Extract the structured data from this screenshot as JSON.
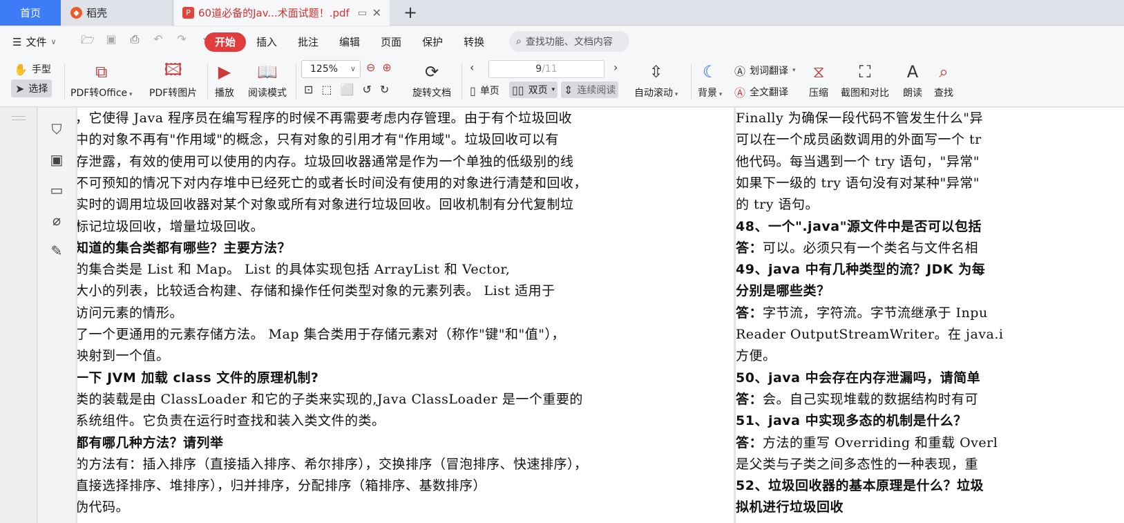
{
  "tabs": {
    "home": "首页",
    "daoke": "稻壳",
    "pdf": "60道必备的Jav...术面试题！.pdf",
    "add": "+"
  },
  "menu": {
    "file": "文件",
    "items": [
      "开始",
      "插入",
      "批注",
      "编辑",
      "页面",
      "保护",
      "转换"
    ],
    "search_placeholder": "查找功能、文档内容"
  },
  "ribbon": {
    "hand": "手型",
    "select": "选择",
    "pdf_to_office": "PDF转Office",
    "pdf_to_image": "PDF转图片",
    "play": "播放",
    "read_mode": "阅读模式",
    "zoom": "125%",
    "rotate": "旋转文档",
    "page_current": "9",
    "page_total": "/11",
    "single": "单页",
    "double": "双页",
    "continuous": "连续阅读",
    "auto_scroll": "自动滚动",
    "background": "背景",
    "word_translate": "划词翻译",
    "full_translate": "全文翻译",
    "compress": "压缩",
    "screenshot": "截图和对比",
    "read_aloud": "朗读",
    "find": "查找"
  },
  "left_page": {
    "lines": [
      "，它使得 Java 程序员在编写程序的时候不再需要考虑内存管理。由于有个垃圾回收",
      "中的对象不再有\"作用域\"的概念，只有对象的引用才有\"作用域\"。垃圾回收可以有",
      "存泄露，有效的使用可以使用的内存。垃圾回收器通常是作为一个单独的低级别的线",
      "不可预知的情况下对内存堆中已经死亡的或者长时间没有使用的对象进行清楚和回收，",
      "实时的调用垃圾回收器对某个对象或所有对象进行垃圾回收。回收机制有分代复制垃",
      "标记垃圾回收，增量垃圾回收。",
      "知道的集合类都有哪些？主要方法？",
      "的集合类是  List  和  Map。  List  的具体实现包括  ArrayList  和  Vector,",
      "大小的列表，比较适合构建、存储和操作任何类型对象的元素列表。  List  适用于",
      "访问元素的情形。",
      "了一个更通用的元素存储方法。  Map  集合类用于存储元素对（称作\"键\"和\"值\"），",
      "映射到一个值。",
      "一下 JVM 加载 class 文件的原理机制?",
      "类的装载是由 ClassLoader 和它的子类来实现的,Java  ClassLoader  是一个重要的",
      "系统组件。它负责在运行时查找和装入类文件的类。",
      "都有哪几种方法？请列举",
      "的方法有：插入排序（直接插入排序、希尔排序），交换排序（冒泡排序、快速排序），",
      "直接选择排序、堆排序），归并排序，分配排序（箱排序、基数排序）",
      "伪代码。"
    ]
  },
  "right_page": {
    "lines": [
      "Finally 为确保一段代码不管发生什么\"异",
      "可以在一个成员函数调用的外面写一个 tr",
      "他代码。每当遇到一个 try 语句，\"异常\"",
      "如果下一级的 try 语句没有对某种\"异常\"",
      "的 try 语句。",
      "48、一个\".java\"源文件中是否可以包括",
      "答：可以。必须只有一个类名与文件名相",
      "49、java 中有几种类型的流？JDK 为每",
      "分别是哪些类？",
      "答：字节流，字符流。字节流继承于 Inpu",
      "Reader  OutputStreamWriter。在 java.i",
      "方便。",
      "50、java 中会存在内存泄漏吗，请简单",
      "答：会。自己实现堆载的数据结构时有可",
      "51、java 中实现多态的机制是什么？",
      "答：方法的重写 Overriding 和重载 Overl",
      "是父类与子类之间多态性的一种表现，重",
      "52、垃圾回收器的基本原理是什么？垃圾",
      "拟机进行垃圾回收"
    ]
  }
}
